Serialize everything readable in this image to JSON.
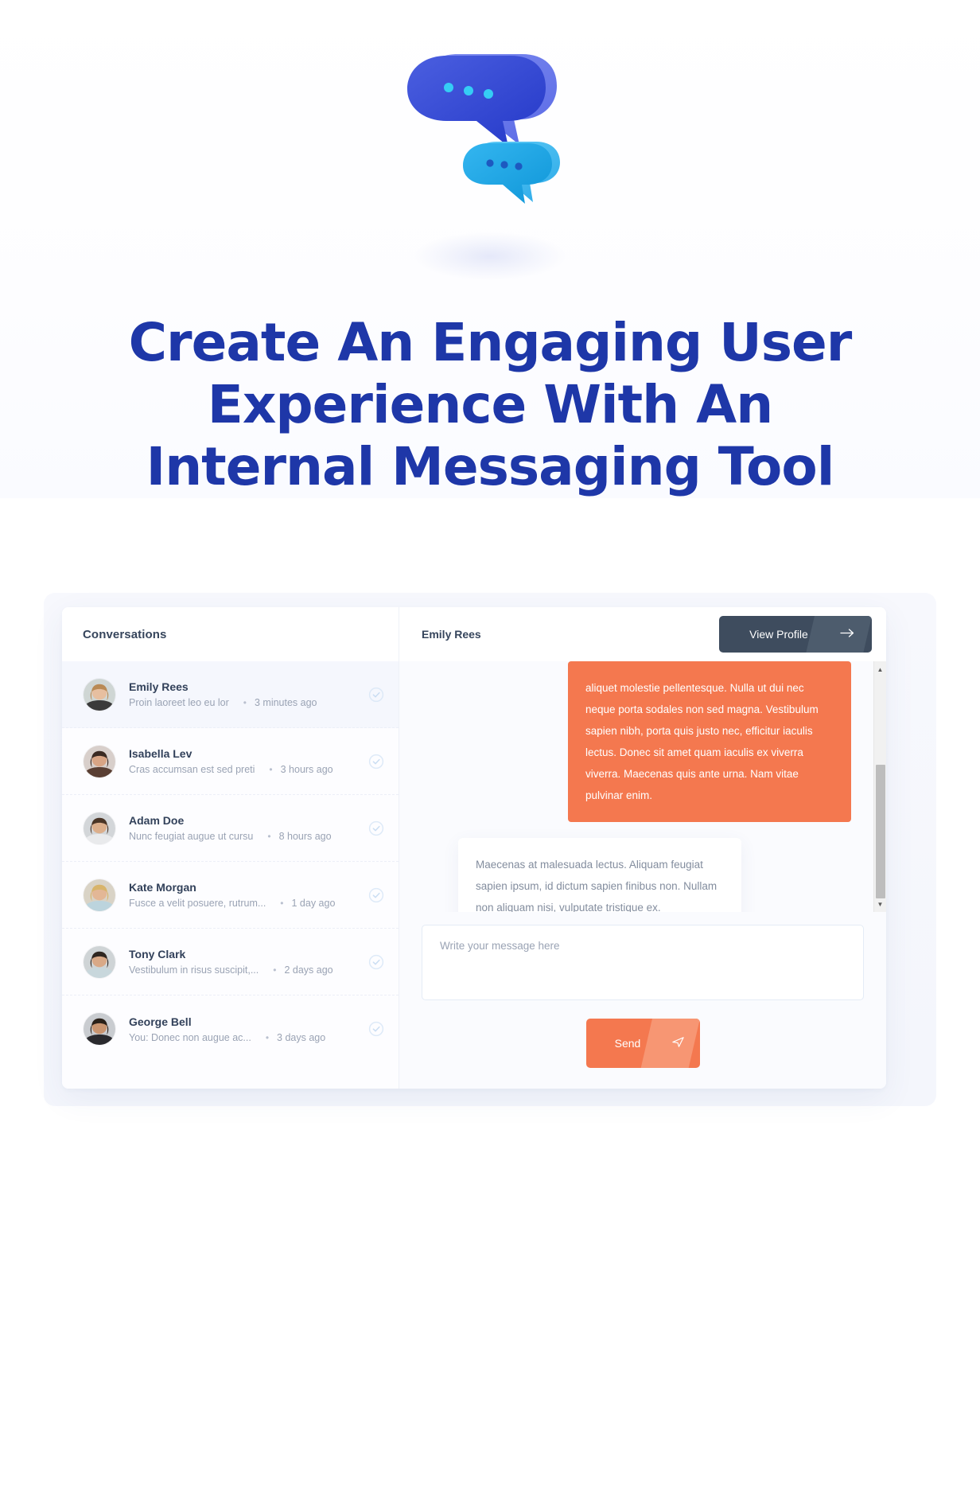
{
  "hero": {
    "illustration_icon": "chat-bubbles-3d-illustration",
    "headline_lines": [
      "Create An Engaging User",
      "Experience With An",
      "Internal Messaging Tool"
    ],
    "headline_color": "#1e37a8"
  },
  "sidebar": {
    "title": "Conversations",
    "conversations": [
      {
        "name": "Emily Rees",
        "snippet": "Proin laoreet leo eu lor",
        "separator": "•",
        "time": "3 minutes ago",
        "status_icon": "check-circle-icon",
        "active": true
      },
      {
        "name": "Isabella Lev",
        "snippet": "Cras accumsan est sed preti",
        "separator": "•",
        "time": "3 hours ago",
        "status_icon": "check-circle-icon",
        "active": false
      },
      {
        "name": "Adam Doe",
        "snippet": "Nunc feugiat augue ut cursu",
        "separator": "•",
        "time": "8 hours ago",
        "status_icon": "check-circle-icon",
        "active": false
      },
      {
        "name": "Kate Morgan",
        "snippet": "Fusce a velit posuere, rutrum...",
        "separator": "•",
        "time": "1 day ago",
        "status_icon": "check-circle-icon",
        "active": false
      },
      {
        "name": "Tony Clark",
        "snippet": "Vestibulum in risus suscipit,...",
        "separator": "•",
        "time": "2 days ago",
        "status_icon": "check-circle-icon",
        "active": false
      },
      {
        "name": "George Bell",
        "snippet": "You: Donec non augue ac...",
        "separator": "•",
        "time": "3 days ago",
        "status_icon": "check-circle-icon",
        "active": false
      }
    ]
  },
  "chat": {
    "title": "Emily Rees",
    "profile_button": {
      "label": "View Profile",
      "icon": "arrow-right-icon"
    },
    "messages": [
      {
        "direction": "sent",
        "text": "aliquet molestie pellentesque. Nulla ut dui nec neque porta sodales non sed magna. Vestibulum sapien nibh, porta quis justo nec, efficitur iaculis lectus. Donec sit amet quam iaculis ex viverra viverra. Maecenas quis ante urna. Nam vitae pulvinar enim."
      },
      {
        "direction": "received",
        "text": "Maecenas at malesuada lectus. Aliquam feugiat sapien ipsum, id dictum sapien finibus non. Nullam non aliquam nisi, vulputate tristique ex. Pellentesque dictum faucibus faucibus."
      }
    ],
    "scrollbar": {
      "up_icon": "▲",
      "down_icon": "▼"
    },
    "composer": {
      "value": "",
      "placeholder": "Write your message here"
    },
    "send_button": {
      "label": "Send",
      "icon": "send-paper-plane-icon"
    }
  },
  "colors": {
    "brand_blue": "#1e37a8",
    "accent_orange": "#f4784f",
    "accent_orange_light": "#f79673",
    "dark_slate": "#3e4c5e",
    "dark_slate_light": "#4d5c6d"
  }
}
